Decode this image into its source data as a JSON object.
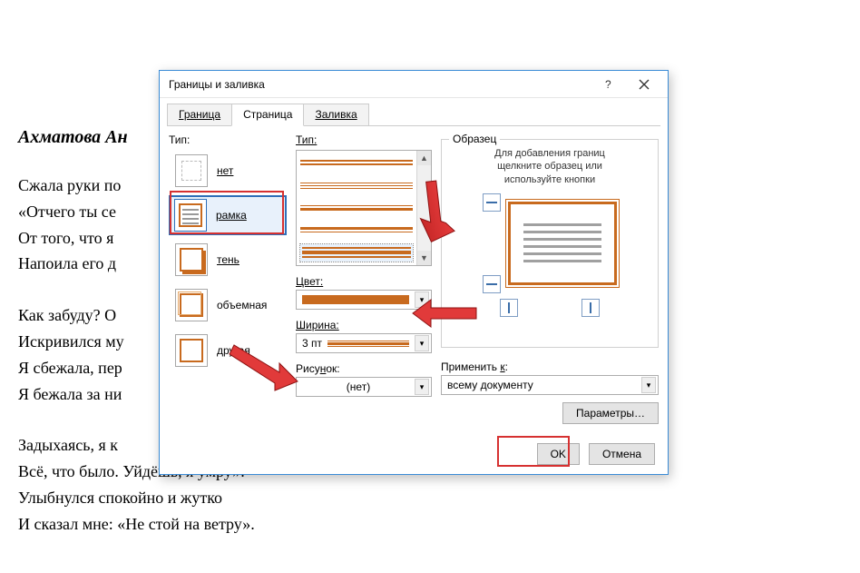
{
  "document": {
    "title": "Ахматова Ан",
    "lines1": [
      "Сжала руки по",
      "«Отчего ты се",
      "От того, что я",
      "Напоила его д"
    ],
    "lines2": [
      "Как забуду? О",
      "Искривился му",
      "Я сбежала, пер",
      "Я бежала за ни"
    ],
    "lines3": [
      "Задыхаясь, я к",
      "Всё, что было. Уйдёшь, я умру».",
      "Улыбнулся спокойно и жутко",
      "И сказал мне: «Не стой на ветру»."
    ]
  },
  "dialog": {
    "title": "Границы и заливка",
    "tabs": {
      "t1": "Граница",
      "t2": "Страница",
      "t3": "Заливка"
    },
    "col1": {
      "label": "Тип:",
      "items": {
        "none": "нет",
        "frame": "рамка",
        "shadow": "тень",
        "threeD": "объемная",
        "other": "другая"
      }
    },
    "col2": {
      "label": "Тип:",
      "colorLabel": "Цвет:",
      "widthLabel": "Ширина:",
      "widthValue": "3 пт",
      "artLabel": "Рисунок:",
      "artValue": "(нет)"
    },
    "col3": {
      "legend": "Образец",
      "hint1": "Для добавления границ",
      "hint2": "щелкните образец или",
      "hint3": "используйте кнопки",
      "applyLabel": "Применить к:",
      "applyValue": "всему документу",
      "paramsBtn": "Параметры…"
    },
    "footer": {
      "ok": "OK",
      "cancel": "Отмена"
    }
  }
}
